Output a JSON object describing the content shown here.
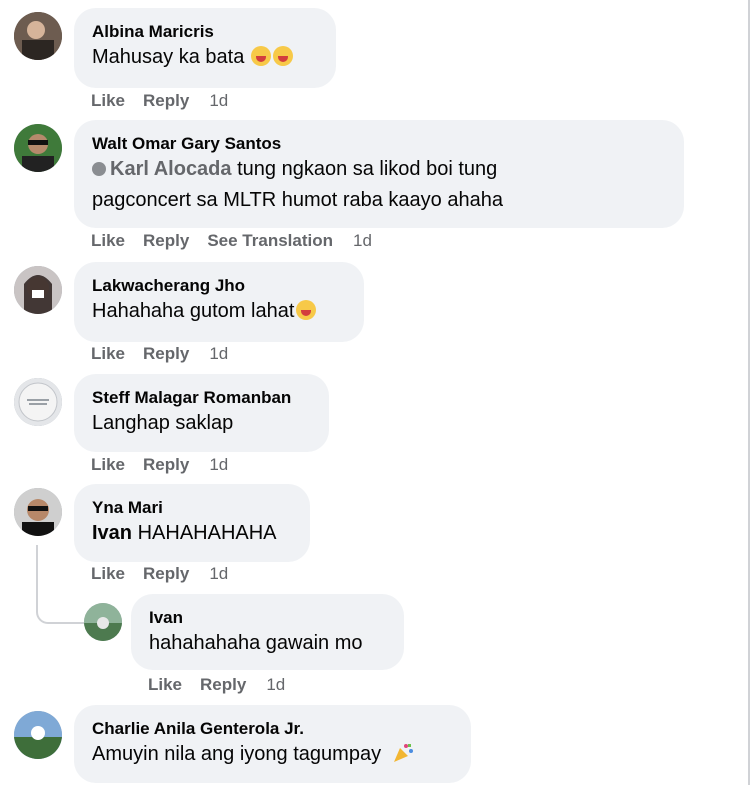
{
  "comments": [
    {
      "author": "Albina Maricris",
      "text": "Mahusay ka bata",
      "actions": {
        "like": "Like",
        "reply": "Reply",
        "time": "1d"
      }
    },
    {
      "author": "Walt Omar Gary Santos",
      "mention": "Karl Alocada",
      "line1": " tung ngkaon sa likod boi tung",
      "line2": "pagconcert sa MLTR humot raba kaayo ahaha",
      "actions": {
        "like": "Like",
        "reply": "Reply",
        "translate": "See Translation",
        "time": "1d"
      }
    },
    {
      "author": "Lakwacherang Jho",
      "text": "Hahahaha gutom lahat",
      "actions": {
        "like": "Like",
        "reply": "Reply",
        "time": "1d"
      }
    },
    {
      "author": "Steff Malagar Romanban",
      "text": "Langhap saklap",
      "actions": {
        "like": "Like",
        "reply": "Reply",
        "time": "1d"
      }
    },
    {
      "author": "Yna Mari",
      "mention": "Ivan",
      "text": " HAHAHAHAHA",
      "actions": {
        "like": "Like",
        "reply": "Reply",
        "time": "1d"
      }
    },
    {
      "author": "Ivan",
      "text": "hahahahaha gawain mo",
      "actions": {
        "like": "Like",
        "reply": "Reply",
        "time": "1d"
      }
    },
    {
      "author": "Charlie Anila Genterola Jr.",
      "text": "Amuyin nila ang iyong tagumpay"
    }
  ],
  "icons": {
    "laugh": "laughing-emoji-icon",
    "party": "party-popper-icon",
    "verified": "verified-badge-icon"
  },
  "colors": {
    "bubble": "#f0f2f5",
    "meta": "#65676b",
    "text": "#050505"
  }
}
